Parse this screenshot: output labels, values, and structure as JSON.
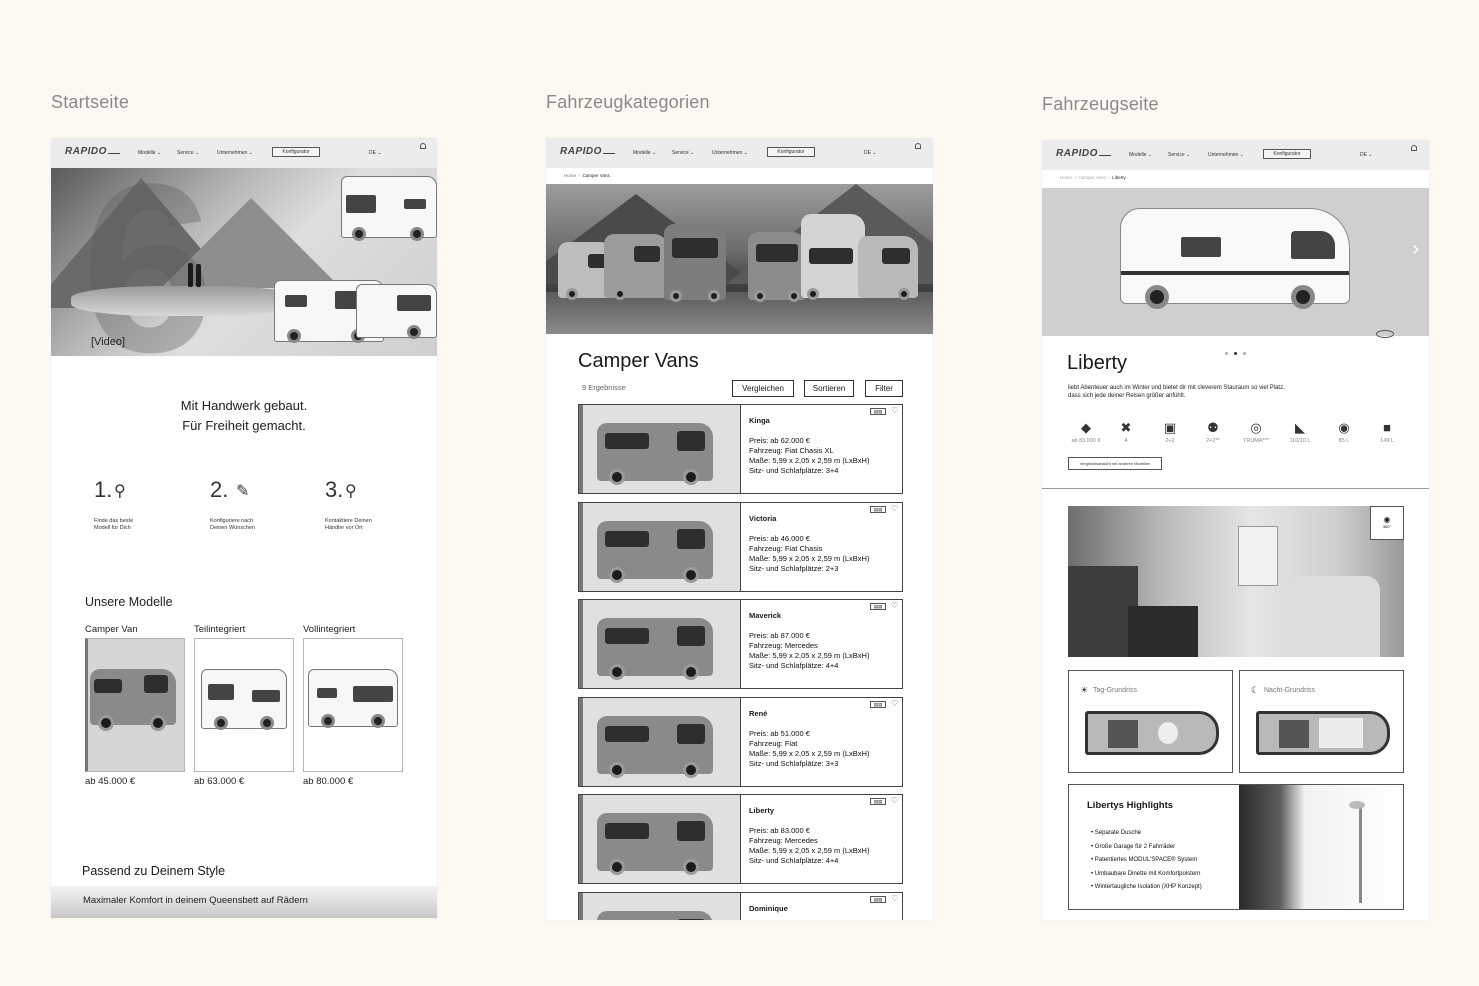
{
  "columns": [
    "Startseite",
    "Fahrzeugkategorien",
    "Fahrzeugseite"
  ],
  "nav": {
    "logo": "RAPIDO",
    "items": [
      "Modelle",
      "Service",
      "Unternehmen"
    ],
    "button": "Konfigurator",
    "lang": "DE"
  },
  "home": {
    "video_label": "[Video]",
    "tagline_1": "Mit Handwerk gebaut.",
    "tagline_2": "Für Freiheit gemacht.",
    "steps": [
      {
        "num": "1.",
        "icon": "search-icon",
        "line1": "Finde das beste",
        "line2": "Modell für Dich"
      },
      {
        "num": "2.",
        "icon": "pencil-icon",
        "line1": "Konfiguriere nach",
        "line2": "Deinen Wünschen"
      },
      {
        "num": "3.",
        "icon": "location-pin-icon",
        "line1": "Kontaktiere Deinen",
        "line2": "Händler vor Ort"
      }
    ],
    "models_title": "Unsere Modelle",
    "models": [
      {
        "label": "Camper Van",
        "price": "ab 45.000 €"
      },
      {
        "label": "Teilintegriert",
        "price": "ab 63.000 €"
      },
      {
        "label": "Vollintegriert",
        "price": "ab 80.000 €"
      }
    ],
    "style_title": "Passend zu Deinem Style",
    "style_text": "Maximaler Komfort in deinem Queensbett auf Rädern"
  },
  "category": {
    "breadcrumb": [
      "Home",
      "Camper Vans"
    ],
    "title": "Camper Vans",
    "results": "9 Ergebnisse",
    "buttons": [
      "Vergleichen",
      "Sortieren",
      "Filter"
    ],
    "compare_badge": "▤▤",
    "cards": [
      {
        "name": "Kinga",
        "info": "Preis: ab 62.000 €\nFahrzeug: Fiat Chasis XL\nMaße: 5,99 x 2,05 x 2,59 m (LxBxH)\nSitz- und Schlafplätze: 3+4"
      },
      {
        "name": "Victoria",
        "info": "Preis: ab 46.000 €\nFahrzeug: Fiat Chasis\nMaße: 5,99 x 2,05 x 2,59 m (LxBxH)\nSitz- und Schlafplätze: 2+3"
      },
      {
        "name": "Maverick",
        "info": "Preis: ab 87.000 €\nFahrzeug: Mercedes\nMaße: 5,99 x 2,05 x 2,59 m (LxBxH)\nSitz- und Schlafplätze: 4+4"
      },
      {
        "name": "René",
        "info": "Preis: ab 51.000 €\nFahrzeug: Fiat\nMaße: 5,99 x 2,05 x 2,59 m (LxBxH)\nSitz- und Schlafplätze: 3+3"
      },
      {
        "name": "Liberty",
        "info": "Preis: ab 83.000 €\nFahrzeug: Mercedes\nMaße: 5,99 x 2,05 x 2,59 m (LxBxH)\nSitz- und Schlafplätze: 4+4"
      },
      {
        "name": "Dominique",
        "info": ""
      }
    ]
  },
  "vehicle": {
    "breadcrumb": [
      "Home",
      "Camper Vans",
      "Liberty"
    ],
    "title": "Liberty",
    "desc": "liebt Abenteuer auch im Winter und bietet dir mit cleverem Stauraum so viel Platz, dass sich jede deiner Reisen größer anfühlt.",
    "specs": [
      {
        "icon": "price-tag-icon",
        "glyph": "◆",
        "value": "ab 83.000 €"
      },
      {
        "icon": "tools-icon",
        "glyph": "✖",
        "value": "4"
      },
      {
        "icon": "seats-icon",
        "glyph": "▣",
        "value": "2+2"
      },
      {
        "icon": "person-icon",
        "glyph": "⚉",
        "value": "2+2**"
      },
      {
        "icon": "heater-icon",
        "glyph": "◎",
        "value": "TRUMA***"
      },
      {
        "icon": "water-tap-icon",
        "glyph": "◣",
        "value": "110/10 L"
      },
      {
        "icon": "fuel-icon",
        "glyph": "◉",
        "value": "85 L"
      },
      {
        "icon": "fridge-icon",
        "glyph": "■",
        "value": "149 L"
      }
    ],
    "compare_link": "Vergleichsansicht mit anderen Modellen",
    "badge_360": "360°",
    "plan_day": "Tag-Grundriss",
    "plan_night": "Nacht-Grundriss",
    "highlights_title": "Libertys Highlights",
    "highlights": [
      "Separate Dusche",
      "Große Garage für 2 Fahrräder",
      "Patentiertes MODUL'SPACE® System",
      "Umbaubare Dinette mit Komfortpolstern",
      "Wintertaugliche Isolation (XHP Konzept)"
    ]
  }
}
